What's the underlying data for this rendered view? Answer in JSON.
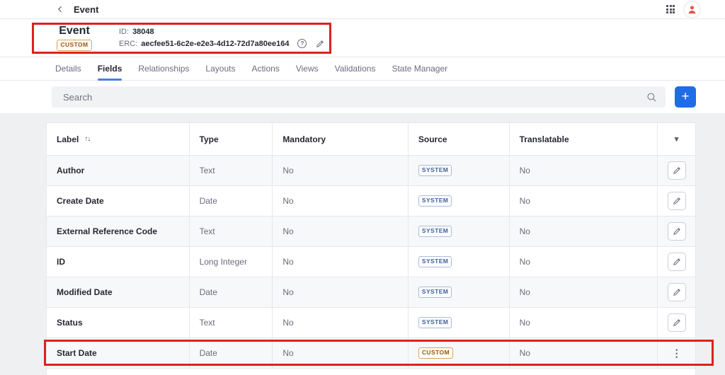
{
  "topbar": {
    "title": "Event"
  },
  "entity_header": {
    "name": "Event",
    "badge": "CUSTOM",
    "id_label": "ID:",
    "id_value": "38048",
    "erc_label": "ERC:",
    "erc_value": "aecfee51-6c2e-e2e3-4d12-72d7a80ee164"
  },
  "tabs": [
    {
      "label": "Details",
      "active": false
    },
    {
      "label": "Fields",
      "active": true
    },
    {
      "label": "Relationships",
      "active": false
    },
    {
      "label": "Layouts",
      "active": false
    },
    {
      "label": "Actions",
      "active": false
    },
    {
      "label": "Views",
      "active": false
    },
    {
      "label": "Validations",
      "active": false
    },
    {
      "label": "State Manager",
      "active": false
    }
  ],
  "search": {
    "placeholder": "Search"
  },
  "icons": {
    "back": "chevron-left-icon",
    "apps": "apps-grid-icon",
    "avatar": "user-avatar-icon",
    "info": "info-circle-icon",
    "edit": "pencil-icon",
    "search": "search-icon",
    "add": "plus-icon",
    "sort_glyph": "↑↓",
    "caret_glyph": "▾",
    "kebab_glyph": "⋮",
    "plus_glyph": "+",
    "info_glyph": "?"
  },
  "table": {
    "columns": [
      "Label",
      "Type",
      "Mandatory",
      "Source",
      "Translatable"
    ],
    "rows": [
      {
        "label": "Author",
        "type": "Text",
        "mandatory": "No",
        "source": "SYSTEM",
        "translatable": "No",
        "action": "edit"
      },
      {
        "label": "Create Date",
        "type": "Date",
        "mandatory": "No",
        "source": "SYSTEM",
        "translatable": "No",
        "action": "edit"
      },
      {
        "label": "External Reference Code",
        "type": "Text",
        "mandatory": "No",
        "source": "SYSTEM",
        "translatable": "No",
        "action": "edit"
      },
      {
        "label": "ID",
        "type": "Long Integer",
        "mandatory": "No",
        "source": "SYSTEM",
        "translatable": "No",
        "action": "edit"
      },
      {
        "label": "Modified Date",
        "type": "Date",
        "mandatory": "No",
        "source": "SYSTEM",
        "translatable": "No",
        "action": "edit"
      },
      {
        "label": "Status",
        "type": "Text",
        "mandatory": "No",
        "source": "SYSTEM",
        "translatable": "No",
        "action": "edit"
      },
      {
        "label": "Start Date",
        "type": "Date",
        "mandatory": "No",
        "source": "CUSTOM",
        "translatable": "No",
        "action": "menu"
      }
    ]
  },
  "colors": {
    "accent_blue": "#1f6ce8",
    "tab_underline": "#4a7de0",
    "annotation_red": "#de2121",
    "system_badge_text": "#41629c",
    "system_badge_border": "#a9bcdd",
    "custom_badge_text": "#9c5617",
    "custom_badge_border": "#d9a45f",
    "avatar_red": "#e0564d",
    "text_primary": "#272833",
    "text_secondary": "#6b6c7e",
    "page_bg": "#eff0f2",
    "search_bg": "#f1f2f4",
    "stripe_bg": "#f7f8f9",
    "border_color": "#e7e7ed"
  }
}
